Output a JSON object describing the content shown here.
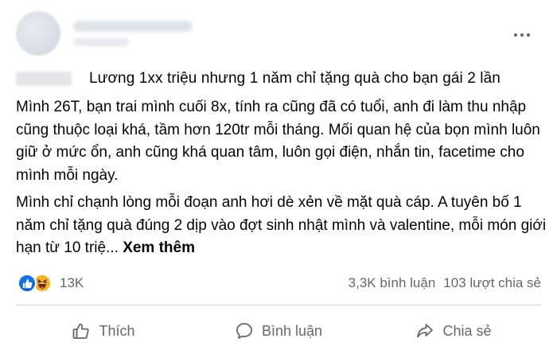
{
  "post": {
    "title_line": "Lương 1xx triệu nhưng 1 năm chỉ tặng quà cho bạn gái 2 lần",
    "paragraph_1": "Mình 26T, bạn trai mình cuối 8x, tính ra cũng đã có tuổi, anh đi làm thu nhập cũng thuộc loại khá, tầm hơn 120tr mỗi tháng. Mối quan hệ của bọn mình luôn giữ ở mức ổn, anh cũng khá quan tâm, luôn gọi điện, nhắn tin, facetime cho mình mỗi ngày.",
    "paragraph_2": "Mình chỉ chạnh lòng mỗi đoạn anh hơi dè xẻn về mặt quà cáp. A tuyên bố 1 năm chỉ tặng quà đúng 2 dịp vào đợt sinh nhật mình và valentine, mỗi món giới hạn từ 10 triệ...",
    "see_more": "Xem thêm"
  },
  "stats": {
    "reaction_count": "13K",
    "comments": "3,3K bình luận",
    "shares": "103 lượt chia sẻ"
  },
  "actions": {
    "like": "Thích",
    "comment": "Bình luận",
    "share": "Chia sẻ"
  },
  "icons": {
    "reactions": [
      "like-icon",
      "haha-icon"
    ],
    "actions": [
      "thumbs-up-icon",
      "comment-icon",
      "share-icon"
    ],
    "more": "more-options-icon"
  },
  "colors": {
    "accent_blue": "#1877f2",
    "haha_yellow": "#f7b125",
    "secondary_text": "#65676b",
    "divider": "#ced0d4"
  }
}
